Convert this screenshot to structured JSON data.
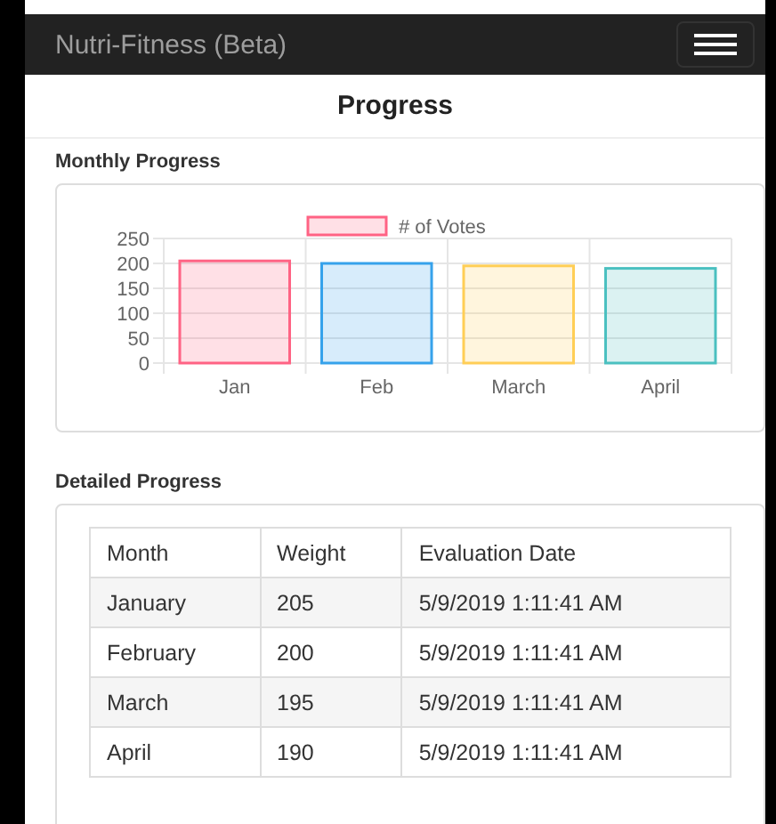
{
  "navbar": {
    "brand": "Nutri-Fitness (Beta)"
  },
  "page_title": "Progress",
  "monthly": {
    "heading": "Monthly Progress",
    "chart_data": {
      "type": "bar",
      "categories": [
        "Jan",
        "Feb",
        "March",
        "April"
      ],
      "series": [
        {
          "name": "# of Votes",
          "values": [
            205,
            200,
            195,
            190
          ]
        }
      ],
      "grid": true,
      "ylim": [
        0,
        250
      ],
      "yticks": [
        0,
        50,
        100,
        150,
        200,
        250
      ]
    },
    "bars": [
      {
        "color": "#ff6384"
      },
      {
        "color": "#36a2eb"
      },
      {
        "color": "#ffce56"
      },
      {
        "color": "#4bc0c0"
      }
    ]
  },
  "detailed": {
    "heading": "Detailed Progress",
    "table": {
      "columns": [
        "Month",
        "Weight",
        "Evaluation Date"
      ],
      "rows": [
        [
          "January",
          "205",
          "5/9/2019 1:11:41 AM"
        ],
        [
          "February",
          "200",
          "5/9/2019 1:11:41 AM"
        ],
        [
          "March",
          "195",
          "5/9/2019 1:11:41 AM"
        ],
        [
          "April",
          "190",
          "5/9/2019 1:11:41 AM"
        ]
      ]
    }
  }
}
